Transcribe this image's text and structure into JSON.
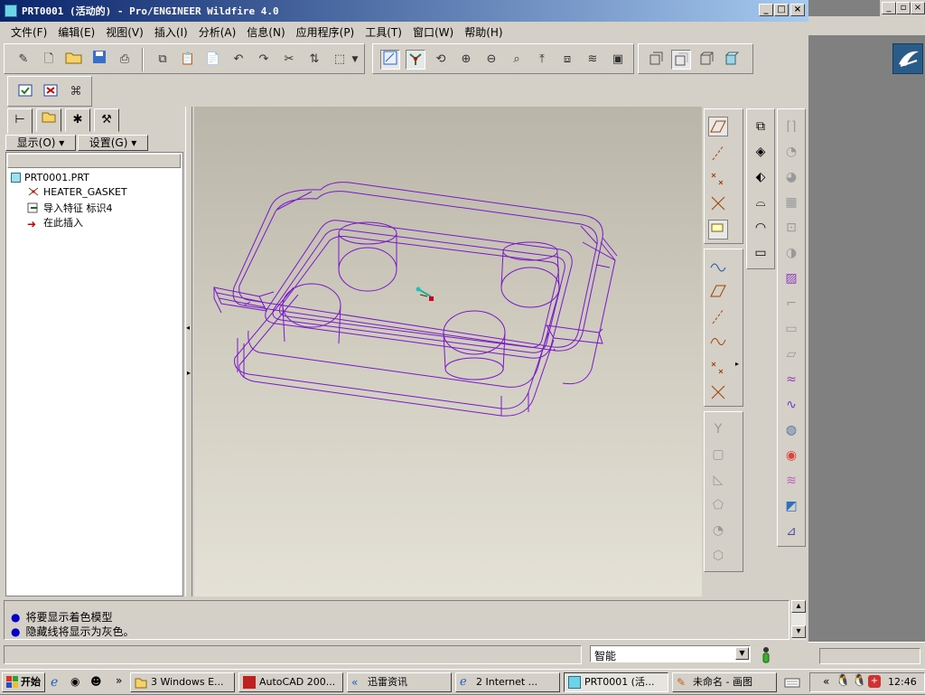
{
  "window": {
    "title": "PRT0001 (活动的) - Pro/ENGINEER Wildfire 4.0",
    "min_label": "_",
    "max_label": "□",
    "close_label": "×"
  },
  "menu": [
    "文件(F)",
    "编辑(E)",
    "视图(V)",
    "插入(I)",
    "分析(A)",
    "信息(N)",
    "应用程序(P)",
    "工具(T)",
    "窗口(W)",
    "帮助(H)"
  ],
  "nav": {
    "show_btn": "显示(O)",
    "settings_btn": "设置(G)"
  },
  "tree": {
    "items": [
      "PRT0001.PRT",
      "HEATER_GASKET",
      "导入特征 标识4",
      "在此插入"
    ]
  },
  "messages": [
    "将要显示着色模型",
    "隐藏线将显示为灰色。"
  ],
  "status": {
    "filter_value": "智能"
  },
  "taskbar": {
    "start": "开始",
    "overflow": "»",
    "tasks": [
      "3 Windows E...",
      "AutoCAD 200...",
      "迅雷资讯",
      "2 Internet ...",
      "PRT0001 (活...",
      "未命名 - 画图"
    ],
    "tray_prefix": "«",
    "clock": "12:46"
  },
  "desktop_window_controls": {
    "min": "_",
    "restore": "▫",
    "close": "×"
  },
  "colors": {
    "title_start": "#0a246a",
    "title_end": "#a6caf0",
    "wireframe": "#7a18c8",
    "canvas_top": "#b9b5a8",
    "canvas_bottom": "#e4e1d6"
  }
}
